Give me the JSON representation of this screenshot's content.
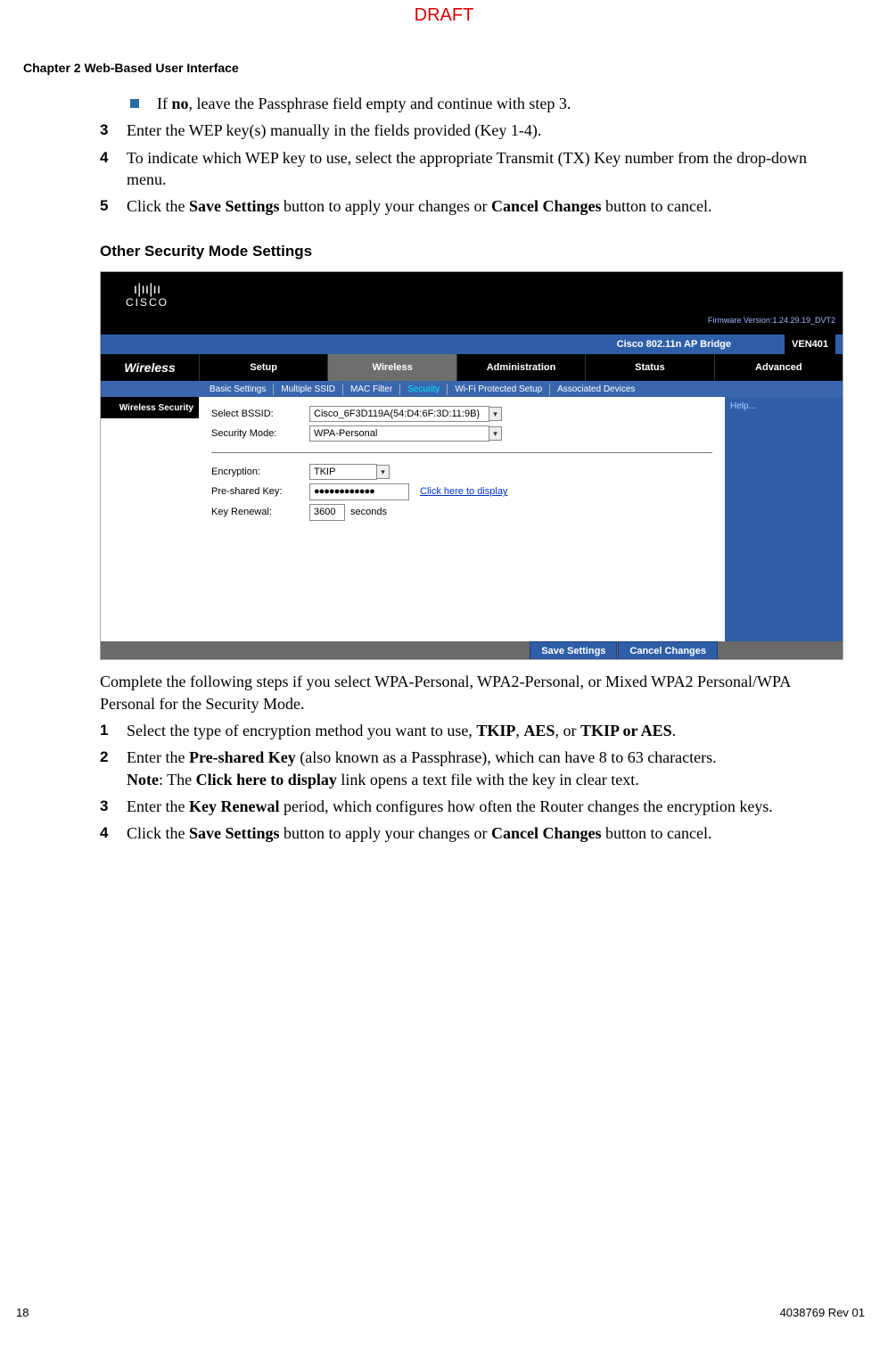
{
  "watermark": "DRAFT",
  "chapter_header": "Chapter 2    Web-Based User Interface",
  "bullet1_pre": "If ",
  "bullet1_bold": "no",
  "bullet1_post": ", leave the Passphrase field empty and continue with step 3.",
  "s3_num": "3",
  "s3_text": "Enter the WEP key(s) manually in the fields provided (Key 1-4).",
  "s4_num": "4",
  "s4_text": "To indicate which WEP key to use, select the appropriate Transmit (TX) Key number from the drop-down menu.",
  "s5_num": "5",
  "s5_pre": "Click the ",
  "s5_b1": "Save Settings",
  "s5_mid": " button to apply your changes or ",
  "s5_b2": "Cancel Changes",
  "s5_post": " button to cancel.",
  "subheading": "Other Security Mode Settings",
  "shot": {
    "cisco_brand": "cisco",
    "firmware": "Firmware Version:1.24.29.19_DVT2",
    "bridge": "Cisco 802.11n AP Bridge",
    "model": "VEN401",
    "section": "Wireless",
    "tabs": {
      "setup": "Setup",
      "wireless": "Wireless",
      "admin": "Administration",
      "status": "Status",
      "advanced": "Advanced"
    },
    "subnav": {
      "basic": "Basic Settings",
      "mssid": "Multiple SSID",
      "mac": "MAC Filter",
      "security": "Security",
      "wps": "Wi-Fi Protected Setup",
      "assoc": "Associated Devices"
    },
    "left_label": "Wireless Security",
    "help": "Help...",
    "labels": {
      "bssid": "Select BSSID:",
      "secmode": "Security Mode:",
      "enc": "Encryption:",
      "psk": "Pre-shared Key:",
      "keyren": "Key Renewal:"
    },
    "values": {
      "bssid": "Cisco_6F3D119A(54:D4:6F:3D:11:9B)",
      "secmode": "WPA-Personal",
      "enc": "TKIP",
      "psk": "●●●●●●●●●●●●",
      "keyren": "3600",
      "seconds": "seconds",
      "display_link": "Click here to display"
    },
    "buttons": {
      "save": "Save Settings",
      "cancel": "Cancel Changes"
    }
  },
  "para_after": "Complete the following steps if you select WPA-Personal, WPA2-Personal, or Mixed WPA2 Personal/WPA Personal for the Security Mode.",
  "b1_num": "1",
  "b1_pre": "Select the type of encryption method you want to use, ",
  "b1_t1": "TKIP",
  "b1_c1": ", ",
  "b1_t2": "AES",
  "b1_c2": ", or ",
  "b1_t3": "TKIP or AES",
  "b1_post": ".",
  "b2_num": "2",
  "b2_pre": "Enter the ",
  "b2_b1": "Pre-shared Key",
  "b2_mid": " (also known as a Passphrase), which can have 8 to 63 characters.",
  "b2_noteb": "Note",
  "b2_notecolon": ": The ",
  "b2_b2": "Click here to display",
  "b2_post": " link opens a text file with the key in clear text.",
  "b3_num": "3",
  "b3_pre": "Enter the ",
  "b3_b1": "Key Renewal",
  "b3_post": " period, which configures how often the Router changes the encryption keys.",
  "b4_num": "4",
  "b4_pre": "Click the ",
  "b4_b1": "Save Settings",
  "b4_mid": " button to apply your changes or ",
  "b4_b2": "Cancel Changes",
  "b4_post": " button to cancel.",
  "footer_left": "18",
  "footer_right": "4038769 Rev 01"
}
